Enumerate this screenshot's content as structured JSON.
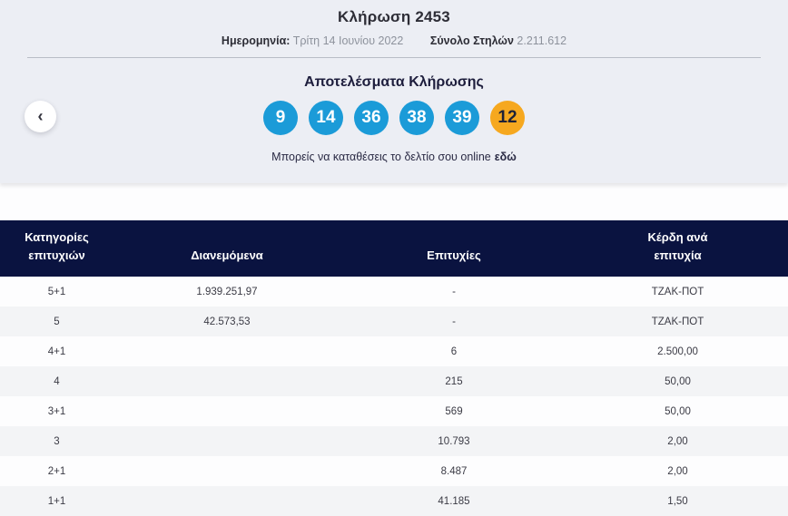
{
  "header": {
    "title": "Κλήρωση 2453",
    "date_label": "Ημερομηνία:",
    "date_value": "Τρίτη 14 Ιουνίου 2022",
    "total_columns_label": "Σύνολο Στηλών",
    "total_columns_value": "2.211.612"
  },
  "results": {
    "heading": "Αποτελέσματα Κλήρωσης",
    "numbers": [
      "9",
      "14",
      "36",
      "38",
      "39"
    ],
    "joker_number": "12",
    "note_text": "Μπορείς να καταθέσεις το δελτίο σου online",
    "note_link_label": "εδώ"
  },
  "icons": {
    "chevron_left": "‹"
  },
  "colors": {
    "number_ball": "#1b9bd8",
    "joker_ball": "#f6a81f",
    "table_header_bg": "#0a1340",
    "section_bg": "#eceef4",
    "row_alt_bg": "#f3f4f6"
  },
  "table": {
    "headers": [
      "Κατηγορίες επιτυχιών",
      "Διανεμόμενα",
      "Επιτυχίες",
      "Κέρδη ανά επιτυχία"
    ],
    "rows": [
      [
        "5+1",
        "1.939.251,97",
        "-",
        "ΤΖΑΚ-ΠΟΤ"
      ],
      [
        "5",
        "42.573,53",
        "-",
        "ΤΖΑΚ-ΠΟΤ"
      ],
      [
        "4+1",
        "",
        "6",
        "2.500,00"
      ],
      [
        "4",
        "",
        "215",
        "50,00"
      ],
      [
        "3+1",
        "",
        "569",
        "50,00"
      ],
      [
        "3",
        "",
        "10.793",
        "2,00"
      ],
      [
        "2+1",
        "",
        "8.487",
        "2,00"
      ],
      [
        "1+1",
        "",
        "41.185",
        "1,50"
      ]
    ]
  }
}
